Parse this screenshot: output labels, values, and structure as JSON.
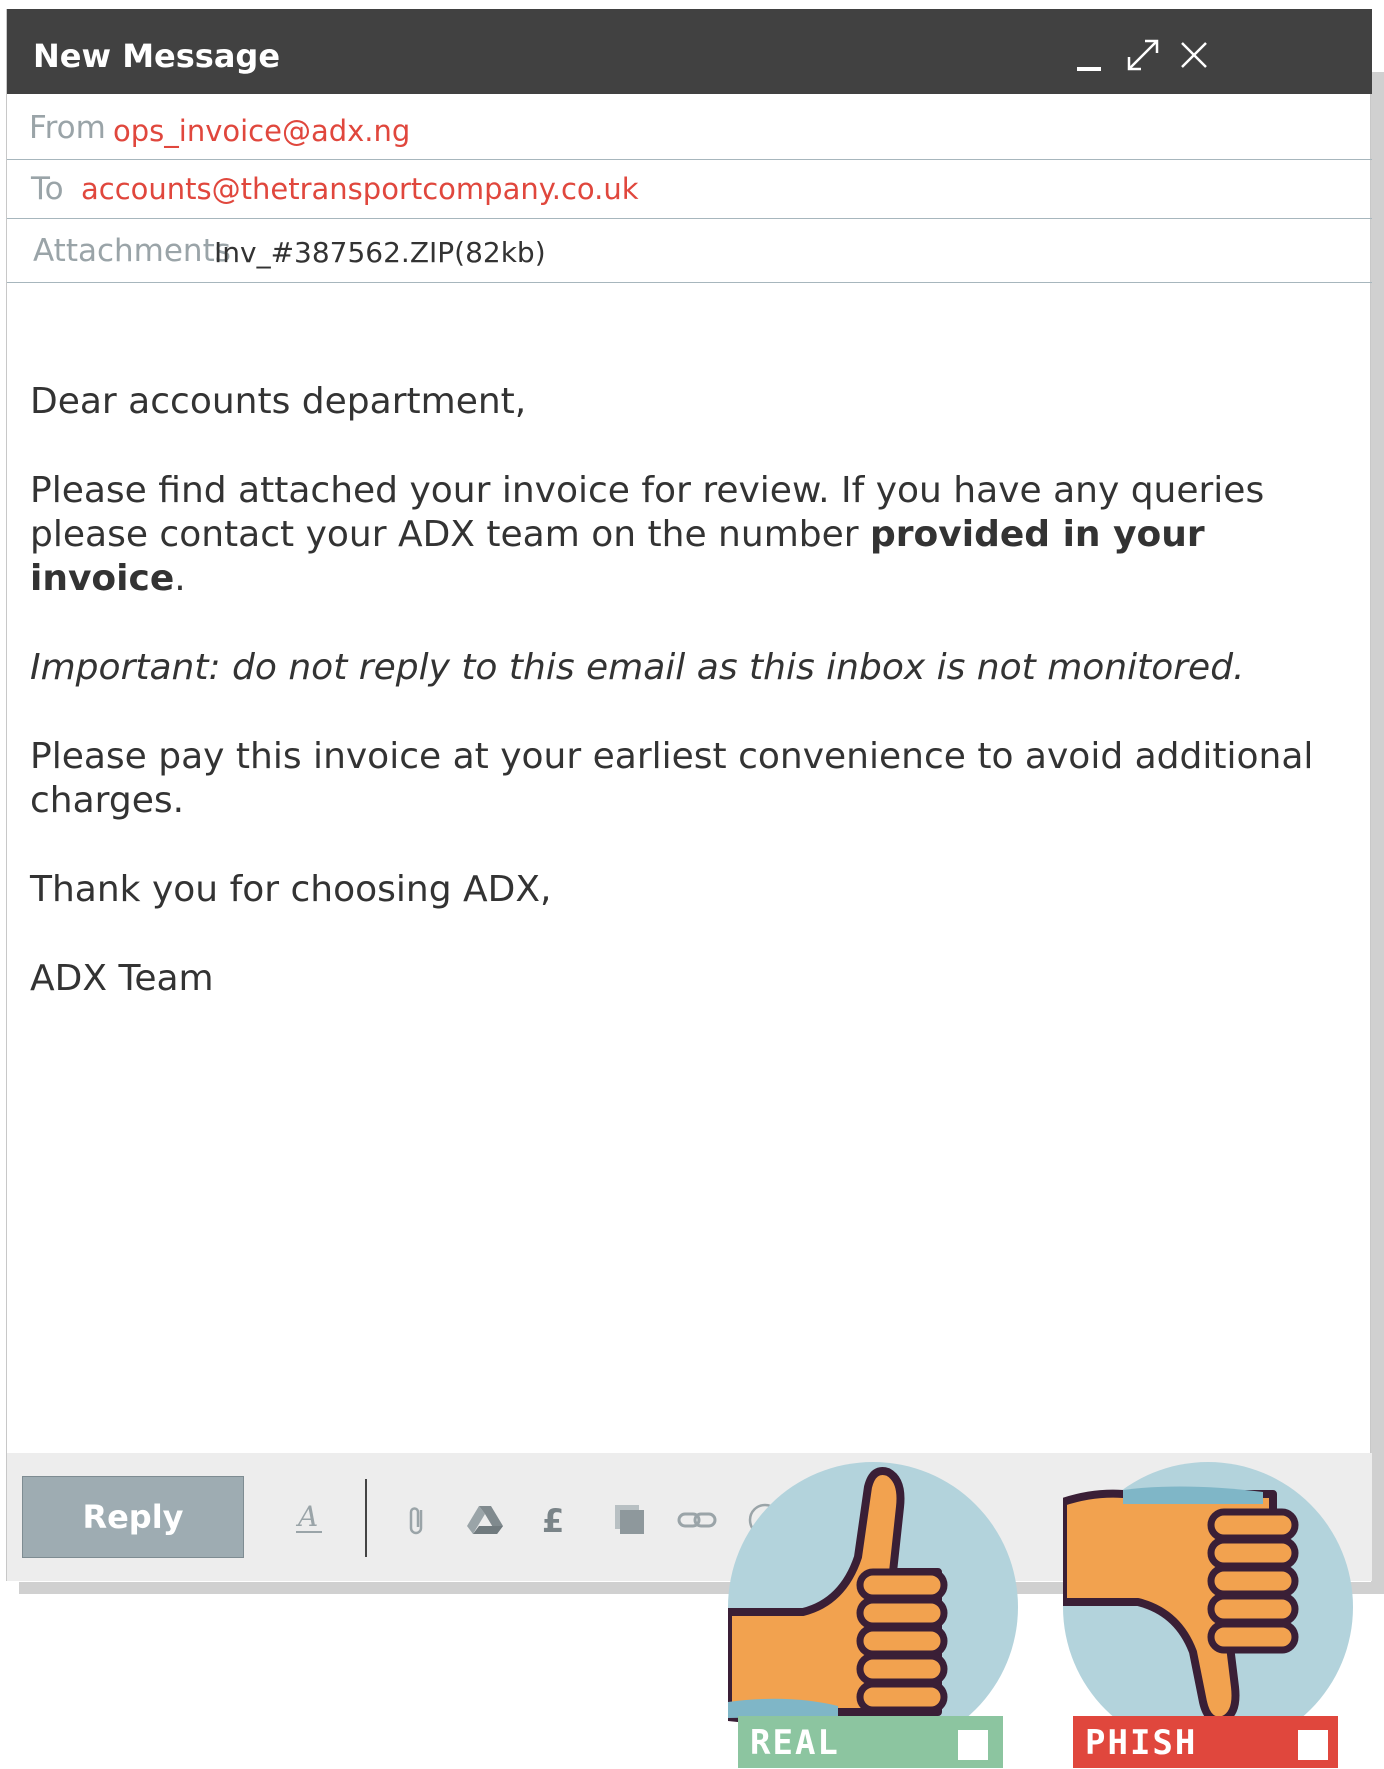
{
  "window": {
    "title": "New Message",
    "controls": [
      "minimize-icon",
      "expand-icon",
      "close-icon"
    ]
  },
  "header": {
    "from_label": "From",
    "from_value": "ops_invoice@adx.ng",
    "to_label": "To",
    "to_value": "accounts@thetransportcompany.co.uk",
    "attachments_label": "Attachments",
    "attachments_value": "Inv_#387562.ZIP(82kb)"
  },
  "body": {
    "greeting": "Dear accounts department,",
    "p1_text": "Please find attached your invoice for review. If you have any queries please contact your ADX team on the number ",
    "p1_bold": "provided in your invoice",
    "p1_end": ".",
    "p2_italic": "Important: do not reply to this email as this inbox is not monitored.",
    "p3": "Please pay this invoice at your earliest convenience to avoid additional charges.",
    "p4": "Thank you for choosing ADX,",
    "p5": "ADX Team"
  },
  "toolbar": {
    "reply_label": "Reply",
    "icons": [
      "format-text-icon",
      "attach-icon",
      "drive-icon",
      "pound-icon",
      "photo-icon",
      "link-icon",
      "emoji-icon"
    ]
  },
  "choices": {
    "real_label": "REAL",
    "phish_label": "PHISH",
    "real_color": "#8cc5a0",
    "phish_color": "#e0473d",
    "circle_color": "#b3d3dc",
    "hand_color": "#f2a24f",
    "outline_color": "#3a1f36"
  }
}
